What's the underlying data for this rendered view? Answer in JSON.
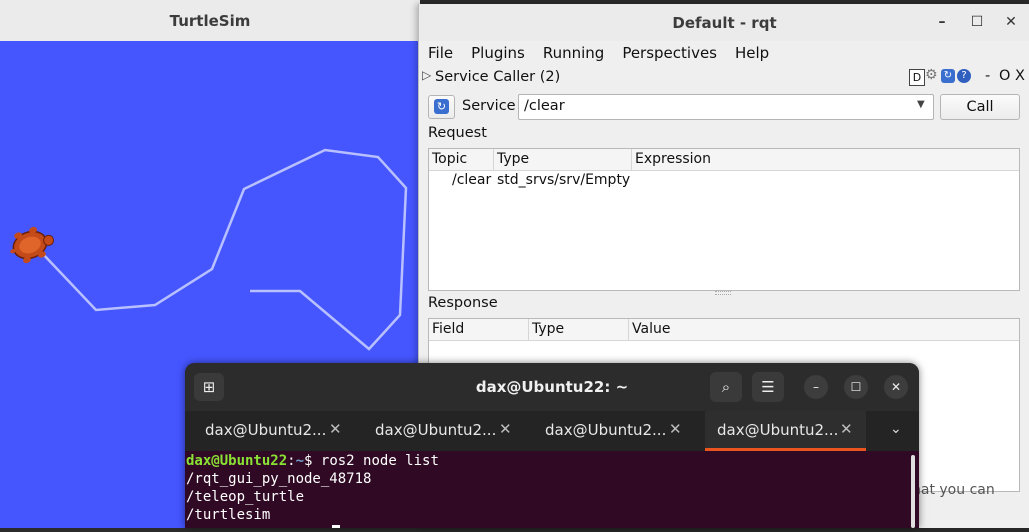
{
  "turtlesim": {
    "title": "TurtleSim",
    "bg_color": "#4556ff",
    "trail_color": "#b8c0ff"
  },
  "rqt": {
    "title": "Default - rqt",
    "window_buttons": {
      "minimize": "–",
      "maximize": "☐",
      "close": "✕"
    },
    "menu": [
      "File",
      "Plugins",
      "Running",
      "Perspectives",
      "Help"
    ],
    "plugin": {
      "title": "Service Caller (2)",
      "controls": {
        "d": "D",
        "minimize": "-",
        "restore": "O",
        "close": "X"
      }
    },
    "service_label": "Service",
    "service_value": "/clear",
    "call_button": "Call",
    "request_label": "Request",
    "request_columns": [
      "Topic",
      "Type",
      "Expression"
    ],
    "request_rows": [
      {
        "topic": "/clear",
        "type": "std_srvs/srv/Empty",
        "expression": ""
      }
    ],
    "response_label": "Response",
    "response_columns": [
      "Field",
      "Type",
      "Value"
    ],
    "hidden_text": "nat you can"
  },
  "terminal": {
    "title": "dax@Ubuntu22: ~",
    "tabs": [
      "dax@Ubuntu2...",
      "dax@Ubuntu2...",
      "dax@Ubuntu2...",
      "dax@Ubuntu2..."
    ],
    "active_tab": 3,
    "prompt_user": "dax@Ubuntu22",
    "prompt_sep": ":",
    "prompt_path": "~",
    "prompt_symbol": "$ ",
    "command": "ros2 node list",
    "output": [
      "/rqt_gui_py_node_48718",
      "/teleop_turtle",
      "/turtlesim"
    ],
    "accent_color": "#e95420"
  }
}
